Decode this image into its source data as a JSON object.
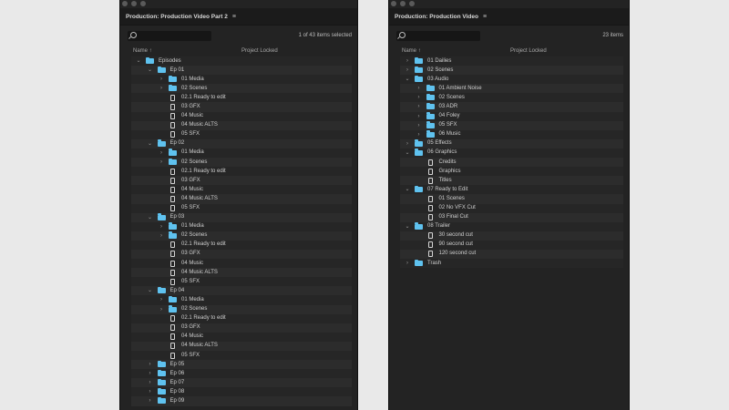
{
  "left_panel": {
    "title": "Production: Production Video Part 2",
    "menu_icon": "hamburger-icon",
    "items_count": "1 of 43 items selected",
    "columns": {
      "name": "Name",
      "locked": "Project Locked"
    },
    "rows": [
      {
        "label": "Episodes",
        "level": 0,
        "type": "folder",
        "expanded": true
      },
      {
        "label": "Ep 01",
        "level": 1,
        "type": "folder",
        "expanded": true
      },
      {
        "label": "01 Media",
        "level": 2,
        "type": "folder",
        "expanded": false
      },
      {
        "label": "02 Scenes",
        "level": 2,
        "type": "folder",
        "expanded": false
      },
      {
        "label": "02.1 Ready to edit",
        "level": 2,
        "type": "sequence"
      },
      {
        "label": "03 GFX",
        "level": 2,
        "type": "sequence"
      },
      {
        "label": "04 Music",
        "level": 2,
        "type": "sequence"
      },
      {
        "label": "04 Music ALTS",
        "level": 2,
        "type": "sequence"
      },
      {
        "label": "05 SFX",
        "level": 2,
        "type": "sequence"
      },
      {
        "label": "Ep 02",
        "level": 1,
        "type": "folder",
        "expanded": true
      },
      {
        "label": "01 Media",
        "level": 2,
        "type": "folder",
        "expanded": false
      },
      {
        "label": "02 Scenes",
        "level": 2,
        "type": "folder",
        "expanded": false
      },
      {
        "label": "02.1 Ready to edit",
        "level": 2,
        "type": "sequence"
      },
      {
        "label": "03 GFX",
        "level": 2,
        "type": "sequence"
      },
      {
        "label": "04 Music",
        "level": 2,
        "type": "sequence"
      },
      {
        "label": "04 Music ALTS",
        "level": 2,
        "type": "sequence"
      },
      {
        "label": "05 SFX",
        "level": 2,
        "type": "sequence"
      },
      {
        "label": "Ep 03",
        "level": 1,
        "type": "folder",
        "expanded": true
      },
      {
        "label": "01 Media",
        "level": 2,
        "type": "folder",
        "expanded": false
      },
      {
        "label": "02 Scenes",
        "level": 2,
        "type": "folder",
        "expanded": false
      },
      {
        "label": "02.1 Ready to edit",
        "level": 2,
        "type": "sequence"
      },
      {
        "label": "03 GFX",
        "level": 2,
        "type": "sequence"
      },
      {
        "label": "04 Music",
        "level": 2,
        "type": "sequence"
      },
      {
        "label": "04 Music ALTS",
        "level": 2,
        "type": "sequence"
      },
      {
        "label": "05 SFX",
        "level": 2,
        "type": "sequence"
      },
      {
        "label": "Ep 04",
        "level": 1,
        "type": "folder",
        "expanded": true
      },
      {
        "label": "01 Media",
        "level": 2,
        "type": "folder",
        "expanded": false
      },
      {
        "label": "02 Scenes",
        "level": 2,
        "type": "folder",
        "expanded": false
      },
      {
        "label": "02.1 Ready to edit",
        "level": 2,
        "type": "sequence"
      },
      {
        "label": "03 GFX",
        "level": 2,
        "type": "sequence"
      },
      {
        "label": "04 Music",
        "level": 2,
        "type": "sequence"
      },
      {
        "label": "04 Music ALTS",
        "level": 2,
        "type": "sequence"
      },
      {
        "label": "05 SFX",
        "level": 2,
        "type": "sequence"
      },
      {
        "label": "Ep 05",
        "level": 1,
        "type": "folder",
        "expanded": false
      },
      {
        "label": "Ep 06",
        "level": 1,
        "type": "folder",
        "expanded": false
      },
      {
        "label": "Ep 07",
        "level": 1,
        "type": "folder",
        "expanded": false
      },
      {
        "label": "Ep 08",
        "level": 1,
        "type": "folder",
        "expanded": false
      },
      {
        "label": "Ep 09",
        "level": 1,
        "type": "folder",
        "expanded": false
      }
    ]
  },
  "right_panel": {
    "title": "Production: Production Video",
    "menu_icon": "hamburger-icon",
    "items_count": "23 items",
    "columns": {
      "name": "Name",
      "locked": "Project Locked"
    },
    "rows": [
      {
        "label": "01 Dailies",
        "level": 0,
        "type": "folder",
        "expanded": false
      },
      {
        "label": "02 Scenes",
        "level": 0,
        "type": "folder",
        "expanded": false
      },
      {
        "label": "03 Audio",
        "level": 0,
        "type": "folder",
        "expanded": true
      },
      {
        "label": "01 Ambient Noise",
        "level": 1,
        "type": "folder",
        "expanded": false
      },
      {
        "label": "02 Scenes",
        "level": 1,
        "type": "folder",
        "expanded": false
      },
      {
        "label": "03 ADR",
        "level": 1,
        "type": "folder",
        "expanded": false
      },
      {
        "label": "04 Foley",
        "level": 1,
        "type": "folder",
        "expanded": false
      },
      {
        "label": "05 SFX",
        "level": 1,
        "type": "folder",
        "expanded": false
      },
      {
        "label": "06 Music",
        "level": 1,
        "type": "folder",
        "expanded": false
      },
      {
        "label": "05 Effects",
        "level": 0,
        "type": "folder",
        "expanded": false
      },
      {
        "label": "06 Graphics",
        "level": 0,
        "type": "folder",
        "expanded": true
      },
      {
        "label": "Credits",
        "level": 1,
        "type": "sequence"
      },
      {
        "label": "Graphics",
        "level": 1,
        "type": "sequence"
      },
      {
        "label": "Titles",
        "level": 1,
        "type": "sequence"
      },
      {
        "label": "07 Ready to Edit",
        "level": 0,
        "type": "folder",
        "expanded": true
      },
      {
        "label": "01 Scenes",
        "level": 1,
        "type": "sequence"
      },
      {
        "label": "02 No VFX Cut",
        "level": 1,
        "type": "sequence"
      },
      {
        "label": "03 Final Cut",
        "level": 1,
        "type": "sequence"
      },
      {
        "label": "08 Trailer",
        "level": 0,
        "type": "folder",
        "expanded": true
      },
      {
        "label": "30 second cut",
        "level": 1,
        "type": "sequence"
      },
      {
        "label": "90 second cut",
        "level": 1,
        "type": "sequence"
      },
      {
        "label": "120 second cut",
        "level": 1,
        "type": "sequence"
      },
      {
        "label": "Trash",
        "level": 0,
        "type": "folder",
        "expanded": false
      }
    ]
  }
}
